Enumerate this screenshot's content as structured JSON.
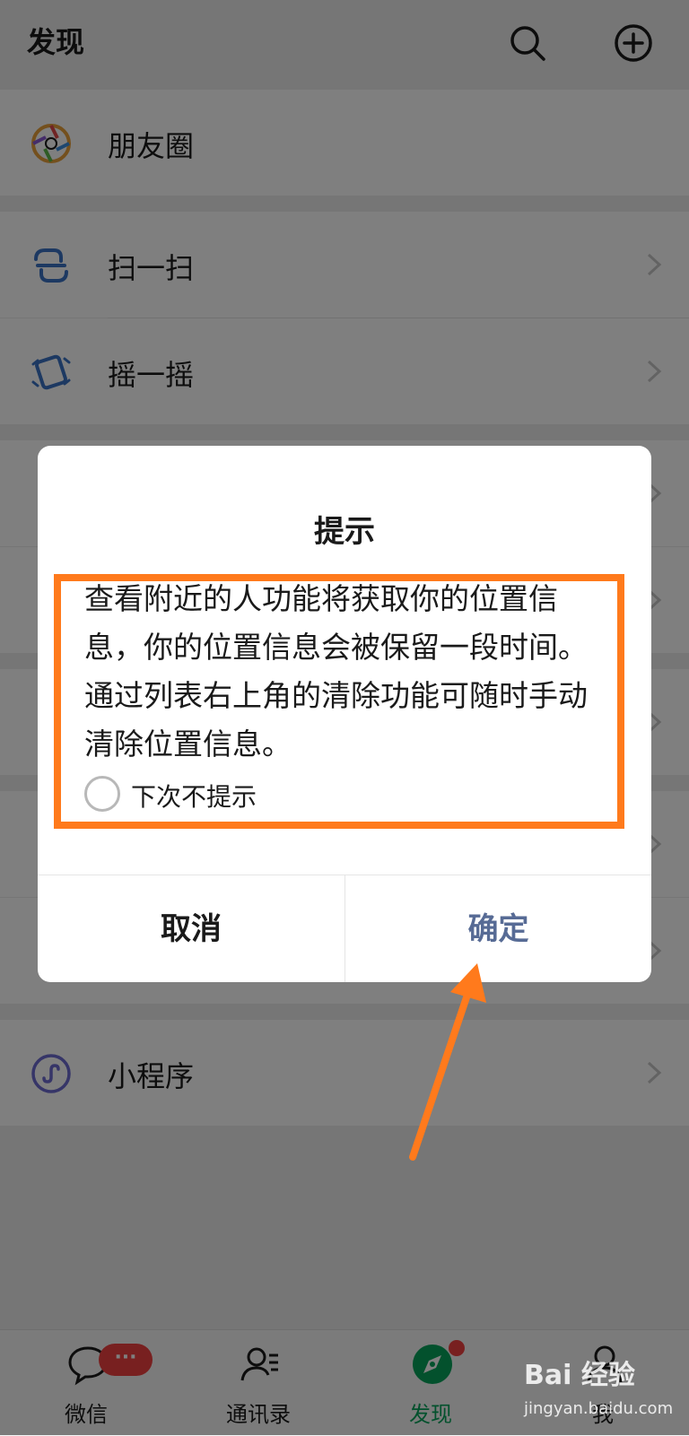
{
  "header": {
    "title": "发现"
  },
  "rows": [
    {
      "label": "朋友圈"
    },
    {
      "label": "扫一扫"
    },
    {
      "label": "摇一摇"
    },
    {
      "label": "小程序"
    }
  ],
  "dialog": {
    "title": "提示",
    "message": "查看附近的人功能将获取你的位置信息，你的位置信息会被保留一段时间。通过列表右上角的清除功能可随时手动清除位置信息。",
    "checkbox_label": "下次不提示",
    "cancel_label": "取消",
    "confirm_label": "确定"
  },
  "tabbar": {
    "tabs": [
      {
        "label": "微信"
      },
      {
        "label": "通讯录"
      },
      {
        "label": "发现",
        "active": true
      },
      {
        "label": "我"
      }
    ],
    "badge": "···"
  },
  "watermark": {
    "brand": "Bai 经验",
    "url": "jingyan.baidu.com"
  },
  "colors": {
    "accent_green": "#07a35a",
    "dialog_confirm": "#576b95",
    "highlight": "#ff7a1c",
    "badge_red": "#f04040"
  },
  "icons": {
    "header_search": "search-icon",
    "header_plus": "plus-circle-icon",
    "moments": "moments-shutter-icon",
    "scan": "scan-icon",
    "shake": "shake-icon",
    "mini_program": "mini-program-icon"
  }
}
